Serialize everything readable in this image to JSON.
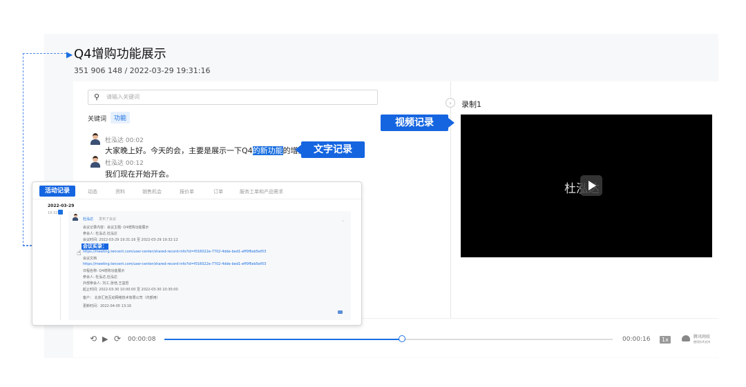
{
  "header": {
    "title": "Q4增购功能展示",
    "meta": "351 906 148  / 2022-03-29 19:31:16"
  },
  "search": {
    "icon": "search-icon",
    "placeholder": "请输入关键词"
  },
  "keywords": {
    "label": "关键词",
    "tag": "功能"
  },
  "transcript": [
    {
      "speaker": "杜泓达 00:02",
      "text_before": "大家晚上好。今天的会，主要是展示一下Q4",
      "highlight": "的新功能",
      "text_after": "的增购。"
    },
    {
      "speaker": "杜泓达 00:12",
      "text": "我们现在开始开会。"
    }
  ],
  "callouts": {
    "text_record": "文字记录",
    "video_record": "视频记录"
  },
  "recording": {
    "label": "录制1",
    "video_name": "杜泓达"
  },
  "overlay": {
    "tabs": [
      "活动记录",
      "动态",
      "资料",
      "销售机会",
      "报价单",
      "订单",
      "服务工单和产品需求"
    ],
    "date": "2022-03-29",
    "time": "19:32",
    "person": "杜泓达",
    "action": "发布了会议",
    "lines": [
      "会议记录内容：会议主题: Q4增购功能展示",
      "参会人: 杜泓达,杜泓达",
      "会议时间: 2022-03-29 19:31:16 至 2022-03-29 19:32:12"
    ],
    "meet_badge": "会议实录：",
    "links": [
      "https://meeting.tencent.com/user-center/shared-record-info?id=f016022e-7702-4dde-bed1-eff0f6eb5ef03",
      "https://meeting.tencent.com/user-center/shared-record-info?id=f016022e-7702-4dde-bed1-eff0f6eb5ef03"
    ],
    "docs_label": "会议文档",
    "lines2": [
      "日程名称: Q4增购功能展示",
      "参会人: 杜泓达,杜泓达",
      "外部参会人: 刘工,张培,王益哲",
      "起止时间: 2022-03-30 10:00:00 至 2022-03-30 10:30:00"
    ],
    "customer": "客户：    北京汇拓互动网络技术有限公司（内部用）",
    "updated": "更新时间：2022-04-05 13:16"
  },
  "player": {
    "current_time": "00:00:08",
    "total_time": "00:00:16",
    "progress": 0.53,
    "speed": "1x",
    "brand_line1": "腾讯网校",
    "brand_line2": "使用技术支持"
  },
  "colors": {
    "accent": "#1565e0",
    "link": "#1a6fe0"
  }
}
